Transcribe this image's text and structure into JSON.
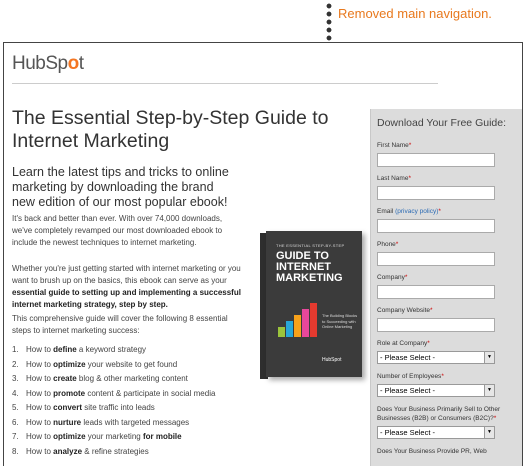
{
  "annotation": {
    "text": "Removed main navigation."
  },
  "logo": {
    "prefix": "HubSp",
    "o": "o",
    "suffix": "t"
  },
  "page": {
    "title": "The Essential Step-by-Step Guide to Internet Marketing",
    "intro": "Learn the latest tips and tricks to online marketing by downloading the brand new edition of our most popular ebook!",
    "para1": "It's back and better than ever. With over 74,000 downloads, we've completely revamped our most downloaded ebook to include the newest techniques to internet marketing.",
    "para2_a": "Whether you're just getting started with internet marketing or you want to brush up on the basics, this ebook can serve as your ",
    "para2_b": "essential guide to setting up and implementing a successful internet marketing strategy, step by step.",
    "para3": "This comprehensive guide will cover the following 8 essential steps to internet marketing success:",
    "steps": [
      {
        "num": "1.",
        "pre": "How to ",
        "bold": "define",
        "post": " a keyword strategy"
      },
      {
        "num": "2.",
        "pre": "How to ",
        "bold": "optimize",
        "post": " your website to get found"
      },
      {
        "num": "3.",
        "pre": "How to ",
        "bold": "create",
        "post": " blog & other marketing content"
      },
      {
        "num": "4.",
        "pre": "How to ",
        "bold": "promote",
        "post": " content & participate in social media"
      },
      {
        "num": "5.",
        "pre": "How to ",
        "bold": "convert",
        "post": " site traffic into leads"
      },
      {
        "num": "6.",
        "pre": "How to ",
        "bold": "nurture",
        "post": " leads with targeted messages"
      },
      {
        "num": "7.",
        "pre": "How to ",
        "bold": "optimize",
        "post": " your marketing ",
        "bold2": "for mobile"
      },
      {
        "num": "8.",
        "pre": "How to ",
        "bold": "analyze",
        "post": " & refine strategies"
      }
    ]
  },
  "ebook": {
    "kicker": "THE ESSENTIAL STEP-BY-STEP",
    "title": "GUIDE TO INTERNET MARKETING",
    "subtitle": "The Building Blocks to Succeeding with Online Marketing",
    "brand": "HubSpot"
  },
  "form": {
    "title": "Download Your Free Guide:",
    "fields": [
      {
        "label": "First Name",
        "required": "*"
      },
      {
        "label": "Last Name",
        "required": "*"
      },
      {
        "label": "Email",
        "link": "(privacy policy)",
        "required": "*"
      },
      {
        "label": "Phone",
        "required": "*"
      },
      {
        "label": "Company",
        "required": "*"
      },
      {
        "label": "Company Website",
        "required": "*"
      }
    ],
    "selects": [
      {
        "label": "Role at Company",
        "required": "*",
        "value": "- Please Select -"
      },
      {
        "label": "Number of Employees",
        "required": "*",
        "value": "- Please Select -"
      },
      {
        "label": "Does Your Business Primarily Sell to Other Businesses (B2B) or Consumers (B2C)?",
        "required": "*",
        "value": "- Please Select -"
      }
    ],
    "cutoff_label": "Does Your Business Provide PR, Web"
  }
}
